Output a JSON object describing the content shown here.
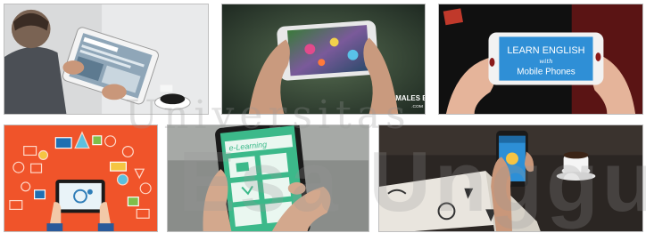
{
  "images": [
    {
      "id_label": "tablet-browsing-photo"
    },
    {
      "id_label": "mobile-game-photo",
      "watermark_text": "MALES BANGET",
      "watermark_sub": ".COM"
    },
    {
      "id_label": "learn-english-photo",
      "line1": "LEARN ENGLISH",
      "line2": "with",
      "line3": "Mobile Phones"
    },
    {
      "id_label": "tablet-icons-illustration"
    },
    {
      "id_label": "elearning-phone-photo",
      "app_title": "e-Learning"
    },
    {
      "id_label": "book-and-phone-photo"
    }
  ],
  "watermark": {
    "line1": "Universitas",
    "line2": "Esa Unggul"
  },
  "colors": {
    "orange_bg": "#f0542a",
    "teal_app": "#3cb98a",
    "blue_banner": "#2f8fd6",
    "border": "#bfbfbf"
  }
}
